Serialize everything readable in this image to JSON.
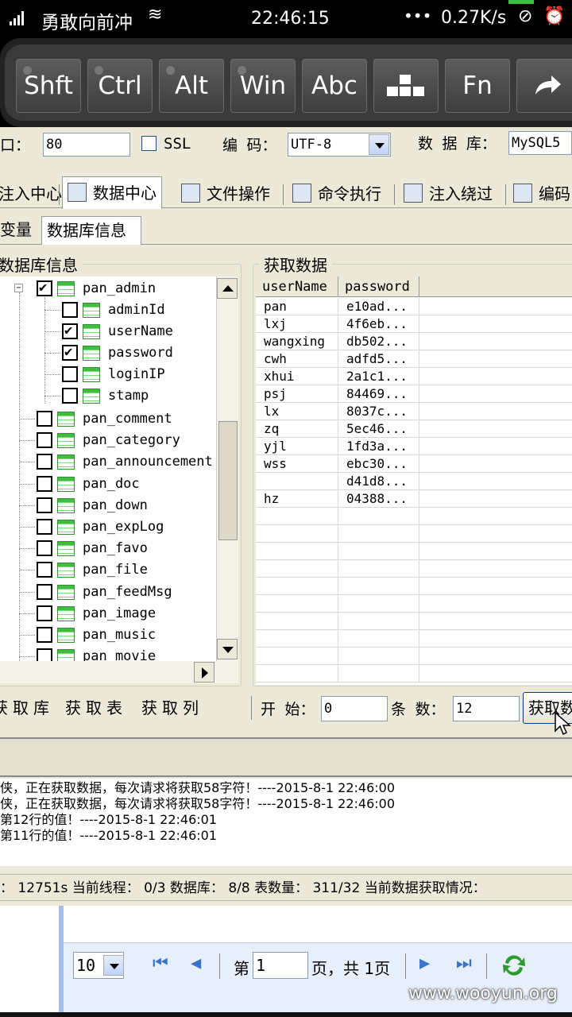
{
  "statusbar": {
    "carrier": "勇敢向前冲",
    "time": "22:46:15",
    "dots": "•••",
    "speed": "0.27K/s"
  },
  "keys": [
    "Shft",
    "Ctrl",
    "Alt",
    "Win",
    "Abc",
    "",
    "Fn",
    ""
  ],
  "conn": {
    "port_label": "口：",
    "port_value": "80",
    "ssl_label": "SSL",
    "encoding_label": "编 码：",
    "encoding_value": "UTF-8",
    "db_label": "数 据 库：",
    "db_value": "MySQL5"
  },
  "tabs": [
    {
      "label": "注入中心"
    },
    {
      "label": "数据中心"
    },
    {
      "label": "文件操作"
    },
    {
      "label": "命令执行"
    },
    {
      "label": "注入绕过"
    },
    {
      "label": "编码"
    }
  ],
  "subtabs": [
    "变量",
    "数据库信息"
  ],
  "db_info": {
    "group_title": "数据库信息",
    "table_open": "pan_admin",
    "columns": [
      {
        "name": "adminId",
        "checked": false
      },
      {
        "name": "userName",
        "checked": true
      },
      {
        "name": "password",
        "checked": true
      },
      {
        "name": "loginIP",
        "checked": false
      },
      {
        "name": "stamp",
        "checked": false
      }
    ],
    "tables": [
      "pan_comment",
      "pan_category",
      "pan_announcement",
      "pan_doc",
      "pan_down",
      "pan_expLog",
      "pan_favo",
      "pan_file",
      "pan_feedMsg",
      "pan_image",
      "pan_music",
      "pan_movie"
    ]
  },
  "fetch": {
    "group_title": "获取数据",
    "headers": [
      "userName",
      "password"
    ],
    "rows": [
      [
        "pan",
        "e10ad..."
      ],
      [
        "lxj",
        "4f6eb..."
      ],
      [
        "wangxing",
        "db502..."
      ],
      [
        "cwh",
        "adfd5..."
      ],
      [
        "xhui",
        "2a1c1..."
      ],
      [
        "psj",
        "84469..."
      ],
      [
        "lx",
        "8037c..."
      ],
      [
        "zq",
        "5ec46..."
      ],
      [
        "yjl",
        "1fd3a..."
      ],
      [
        "wss",
        "ebc30..."
      ],
      [
        "",
        "d41d8..."
      ],
      [
        "hz",
        "04388..."
      ]
    ]
  },
  "actions": {
    "get_db": "获取库",
    "get_table": "获取表",
    "get_column": "获取列",
    "start_label": "开 始：",
    "start_value": "0",
    "count_label": "条 数：",
    "count_value": "12",
    "fetch_button": "获取数据"
  },
  "log": [
    "侠，正在获取数据，每次请求将获取58字符！----2015-8-1 22:46:00",
    "侠，正在获取数据，每次请求将获取58字符！----2015-8-1 22:46:00",
    "第12行的值！----2015-8-1 22:46:01",
    "第11行的值！----2015-8-1 22:46:01"
  ],
  "status_line": "： 12751s 当前线程： 0/3 数据库： 8/8 表数量： 311/32 当前数据获取情况：",
  "pager": {
    "page_size": "10",
    "page_prefix": "第",
    "page_value": "1",
    "page_suffix": "页，共 1页"
  },
  "watermark": "www.wooyun.org"
}
